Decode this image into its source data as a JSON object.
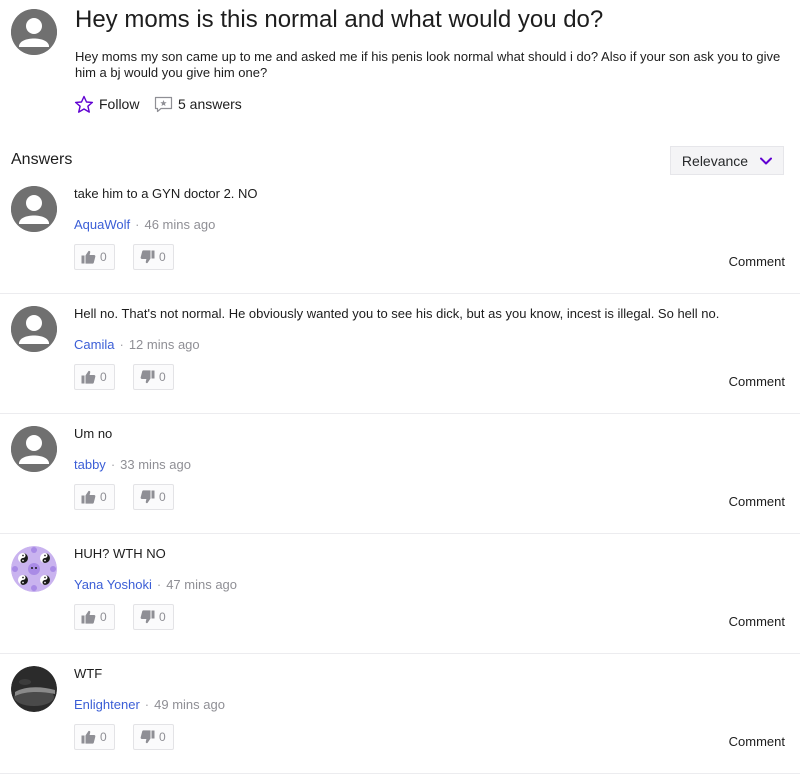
{
  "question": {
    "title": "Hey moms is this normal and what would you do?",
    "body": "Hey moms my son came up to me and asked me if his penis look normal what should i do? Also if your son ask you to give him a bj would you give him one?",
    "follow_label": "Follow",
    "answers_count_label": "5 answers"
  },
  "answers_section": {
    "heading": "Answers",
    "sort_label": "Relevance"
  },
  "colors": {
    "accent_purple": "#6001d2",
    "author_link": "#3b5ed6"
  },
  "answers": [
    {
      "text": "take him to a GYN doctor 2. NO",
      "author": "AquaWolf",
      "time": "46 mins ago",
      "upvotes": "0",
      "downvotes": "0",
      "comment_label": "Comment",
      "avatar": "default-avatar"
    },
    {
      "text": "Hell no. That's not normal. He obviously wanted you to see his dick, but as you know, incest is illegal. So hell no.",
      "author": "Camila",
      "time": "12 mins ago",
      "upvotes": "0",
      "downvotes": "0",
      "comment_label": "Comment",
      "avatar": "default-avatar"
    },
    {
      "text": "Um no",
      "author": "tabby",
      "time": "33 mins ago",
      "upvotes": "0",
      "downvotes": "0",
      "comment_label": "Comment",
      "avatar": "default-avatar"
    },
    {
      "text": "HUH? WTH NO",
      "author": "Yana Yoshoki",
      "time": "47 mins ago",
      "upvotes": "0",
      "downvotes": "0",
      "comment_label": "Comment",
      "avatar": "yin-yang-pattern-avatar"
    },
    {
      "text": "WTF",
      "author": "Enlightener",
      "time": "49 mins ago",
      "upvotes": "0",
      "downvotes": "0",
      "comment_label": "Comment",
      "avatar": "dark-photo-avatar"
    }
  ]
}
